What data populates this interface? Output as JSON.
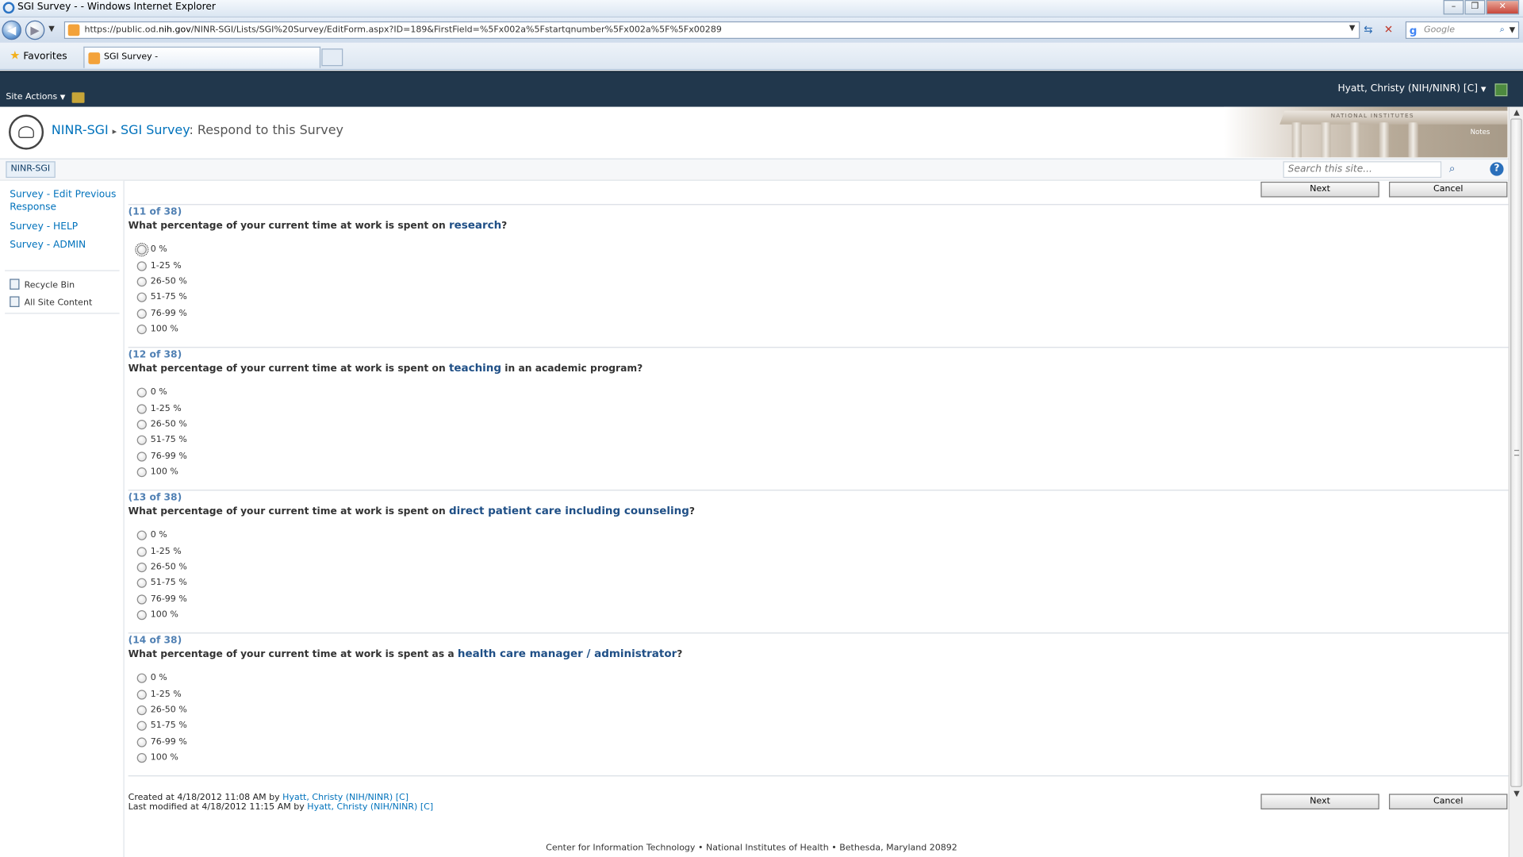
{
  "window": {
    "title": "SGI Survey - - Windows Internet Explorer"
  },
  "addressbar": {
    "url_prefix": "https://public.od.",
    "url_domain": "nih.gov",
    "url_suffix": "/NINR-SGI/Lists/SGI%20Survey/EditForm.aspx?ID=189&FirstField=%5Fx002a%5Fstartqnumber%5Fx002a%5F%5Fx00289",
    "search_placeholder": "Google"
  },
  "favbar": {
    "favorites_label": "Favorites",
    "tab_label": "SGI Survey -"
  },
  "ribbon": {
    "site_actions": "Site Actions",
    "user": "Hyatt, Christy (NIH/NINR) [C]"
  },
  "header": {
    "site": "NINR-SGI",
    "list": "SGI Survey",
    "page": ": Respond to this Survey",
    "banner_text": "NATIONAL INSTITUTES",
    "banner_notes": "Notes"
  },
  "toprow": {
    "crumb_tab": "NINR-SGI",
    "search_placeholder": "Search this site...",
    "help": "?"
  },
  "leftnav": {
    "links": [
      "Survey - Edit Previous Response",
      "Survey - HELP",
      "Survey - ADMIN"
    ],
    "recycle_bin": "Recycle Bin",
    "all_site_content": "All Site Content"
  },
  "buttons": {
    "next": "Next",
    "cancel": "Cancel"
  },
  "questions": [
    {
      "number": "(11 of 38)",
      "prefix": "What percentage of your current time at work is spent on ",
      "keyword": "research",
      "suffix": "?"
    },
    {
      "number": "(12 of 38)",
      "prefix": "What percentage of your current time at work is spent on ",
      "keyword": "teaching",
      "suffix": " in an academic program?"
    },
    {
      "number": "(13 of 38)",
      "prefix": "What percentage of your current time at work is spent on ",
      "keyword": "direct patient care including counseling",
      "suffix": "?"
    },
    {
      "number": "(14 of 38)",
      "prefix": "What percentage of your current time at work is spent as a ",
      "keyword": "health care manager / administrator",
      "suffix": "?"
    }
  ],
  "options": [
    "0 %",
    "1-25 %",
    "26-50 %",
    "51-75 %",
    "76-99 %",
    "100 %"
  ],
  "meta": {
    "created_prefix": "Created at 4/18/2012 11:08 AM  by ",
    "created_by": "Hyatt, Christy (NIH/NINR) [C]",
    "modified_prefix": "Last modified at 4/18/2012 11:15 AM  by ",
    "modified_by": "Hyatt, Christy (NIH/NINR) [C]"
  },
  "footer": "Center for Information Technology • National Institutes of Health • Bethesda, Maryland 20892"
}
